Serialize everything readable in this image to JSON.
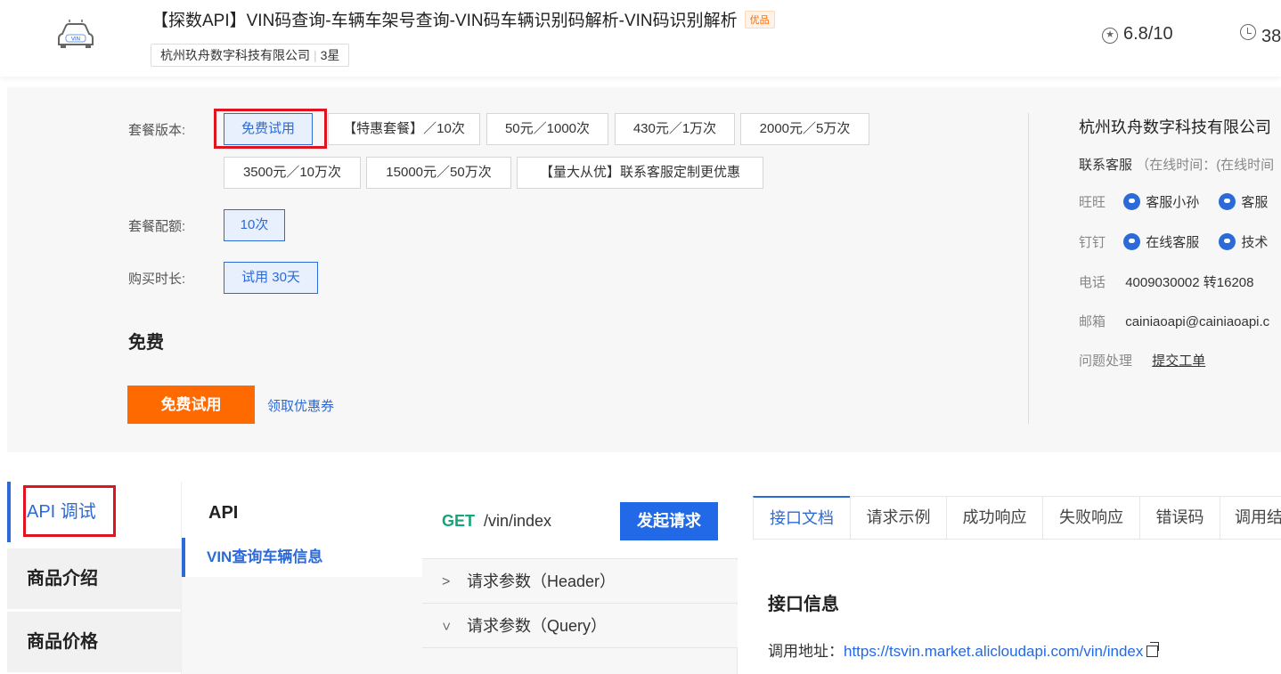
{
  "header": {
    "title": "【探数API】VIN码查询-车辆车架号查询-VIN码车辆识别码解析-VIN码识别解析",
    "premium_badge": "优品",
    "company": "杭州玖舟数字科技有限公司",
    "company_rating": "3星",
    "score": "6.8/10",
    "calls_partial": "38",
    "logo_text": "VIN"
  },
  "purchase": {
    "version_label": "套餐版本:",
    "versions": [
      "免费试用",
      "【特惠套餐】／10次",
      "50元／1000次",
      "430元／1万次",
      "2000元／5万次",
      "3500元／10万次",
      "15000元／50万次",
      "【量大从优】联系客服定制更优惠"
    ],
    "quota_label": "套餐配额:",
    "quota_value": "10次",
    "duration_label": "购买时长:",
    "duration_value": "试用 30天",
    "price": "免费",
    "try_button": "免费试用",
    "coupon_link": "领取优惠券"
  },
  "seller": {
    "name": "杭州玖舟数字科技有限公司",
    "contact_label": "联系客服",
    "online_time": "（在线时间：(在线时间",
    "wangwang_label": "旺旺",
    "wangwang_1": "客服小孙",
    "wangwang_2": "客服",
    "dingding_label": "钉钉",
    "dingding_1": "在线客服",
    "dingding_2": "技术",
    "phone_label": "电话",
    "phone": "4009030002 转16208",
    "email_label": "邮箱",
    "email": "cainiaoapi@cainiaoapi.c",
    "issue_label": "问题处理",
    "issue_link": "提交工单"
  },
  "leftnav": {
    "items": [
      "API 调试",
      "商品介绍",
      "商品价格"
    ]
  },
  "api_list": {
    "heading": "API",
    "selected": "VIN查询车辆信息"
  },
  "request": {
    "method": "GET",
    "path": "/vin/index",
    "send_button": "发起请求",
    "header_params": "请求参数（Header）",
    "query_params": "请求参数（Query）"
  },
  "docs": {
    "tabs": [
      "接口文档",
      "请求示例",
      "成功响应",
      "失败响应",
      "错误码",
      "调用结"
    ],
    "heading": "接口信息",
    "url_label": "调用地址：",
    "url": "https://tsvin.market.alicloudapi.com/vin/index"
  },
  "colors": {
    "accent": "#2c6ad8",
    "orange": "#ff6a00",
    "highlight": "#e0141e",
    "get": "#1aa37a"
  }
}
